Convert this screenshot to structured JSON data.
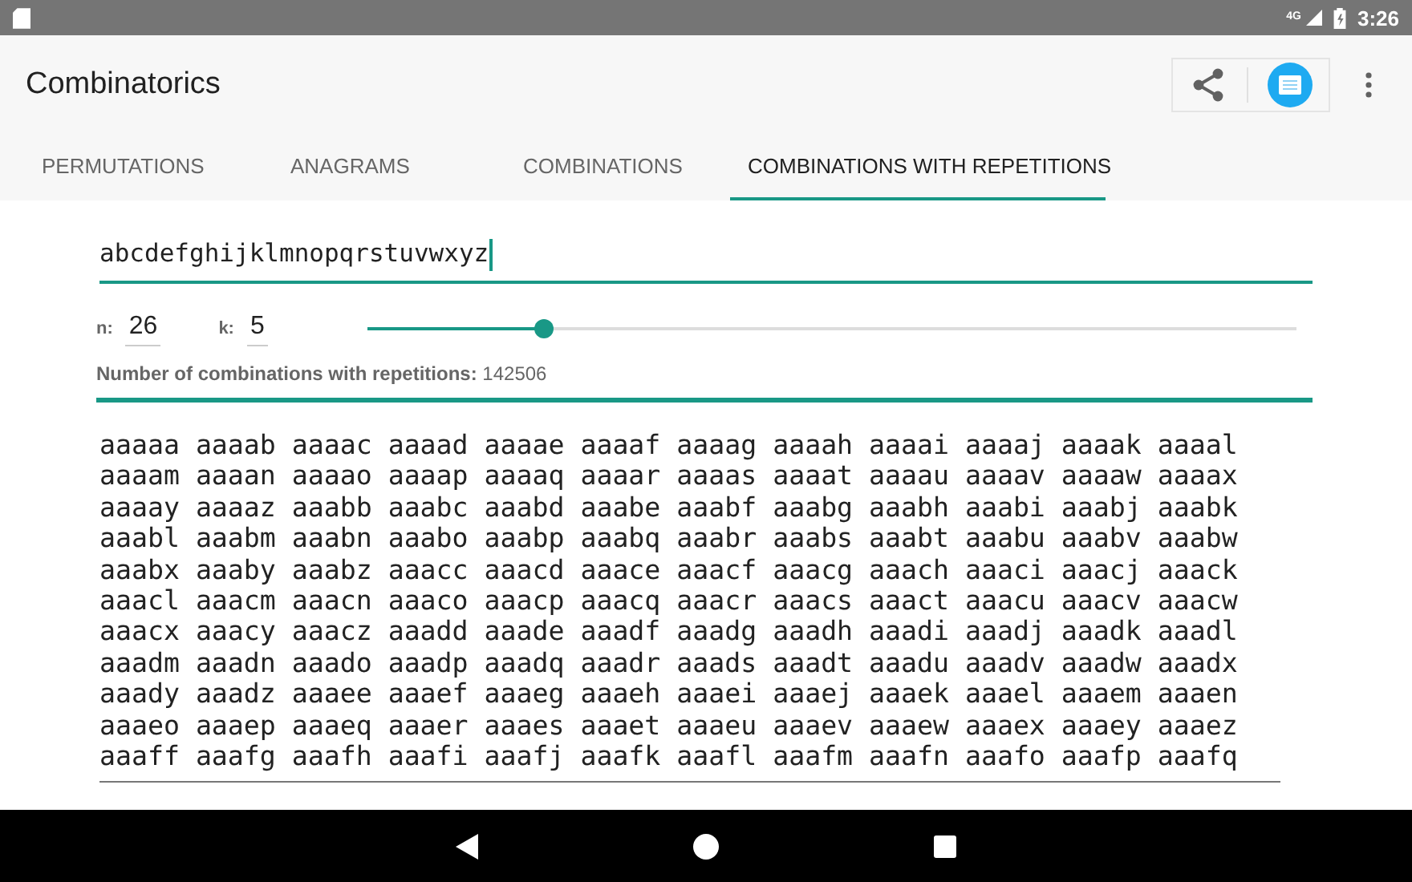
{
  "status_bar": {
    "network": "4G",
    "time": "3:26"
  },
  "app_bar": {
    "title": "Combinatorics"
  },
  "tabs": [
    {
      "label": "PERMUTATIONS",
      "selected": false
    },
    {
      "label": "ANAGRAMS",
      "selected": false
    },
    {
      "label": "COMBINATIONS",
      "selected": false
    },
    {
      "label": "COMBINATIONS WITH REPETITIONS",
      "selected": true
    }
  ],
  "input": {
    "value": "abcdefghijklmnopqrstuvwxyz"
  },
  "params": {
    "n_label": "n:",
    "n_value": "26",
    "k_label": "k:",
    "k_value": "5",
    "slider": {
      "level": 0.19
    }
  },
  "count": {
    "label": "Number of combinations with repetitions:",
    "value": "142506"
  },
  "results": [
    "aaaaa aaaab aaaac aaaad aaaae aaaaf aaaag aaaah aaaai aaaaj aaaak aaaal",
    "aaaam aaaan aaaao aaaap aaaaq aaaar aaaas aaaat aaaau aaaav aaaaw aaaax",
    "aaaay aaaaz aaabb aaabc aaabd aaabe aaabf aaabg aaabh aaabi aaabj aaabk",
    "aaabl aaabm aaabn aaabo aaabp aaabq aaabr aaabs aaabt aaabu aaabv aaabw",
    "aaabx aaaby aaabz aaacc aaacd aaace aaacf aaacg aaach aaaci aaacj aaack",
    "aaacl aaacm aaacn aaaco aaacp aaacq aaacr aaacs aaact aaacu aaacv aaacw",
    "aaacx aaacy aaacz aaadd aaade aaadf aaadg aaadh aaadi aaadj aaadk aaadl",
    "aaadm aaadn aaado aaadp aaadq aaadr aaads aaadt aaadu aaadv aaadw aaadx",
    "aaady aaadz aaaee aaaef aaaeg aaaeh aaaei aaaej aaaek aaael aaaem aaaen",
    "aaaeo aaaep aaaeq aaaer aaaes aaaet aaaeu aaaev aaaew aaaex aaaey aaaez",
    "aaaff aaafg aaafh aaafi aaafj aaafk aaafl aaafm aaafn aaafo aaafp aaafq"
  ]
}
